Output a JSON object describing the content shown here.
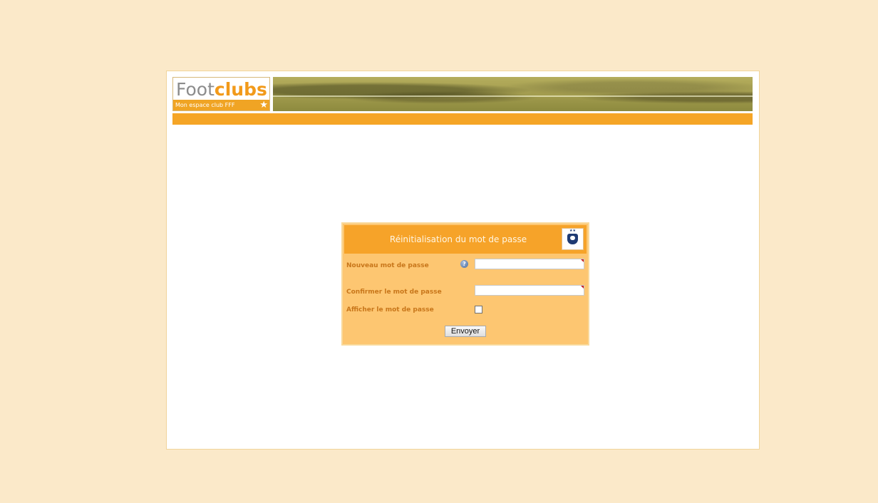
{
  "header": {
    "logo_prefix": "Foot",
    "logo_accent": "clubs",
    "logo_tagline": "Mon espace club FFF",
    "logo_star": "★"
  },
  "dialog": {
    "title": "Réinitialisation du mot de passe",
    "fields": {
      "new_password_label": "Nouveau mot de passe",
      "confirm_password_label": "Confirmer le mot de passe",
      "show_password_label": "Afficher le mot de passe"
    },
    "submit_label": "Envoyer",
    "help_icon_glyph": "?",
    "fff_stars": "★★"
  },
  "colors": {
    "page_background": "#fbe9c9",
    "accent_orange": "#f5a526",
    "dialog_background": "#fdc671",
    "label_color": "#c8761a"
  }
}
